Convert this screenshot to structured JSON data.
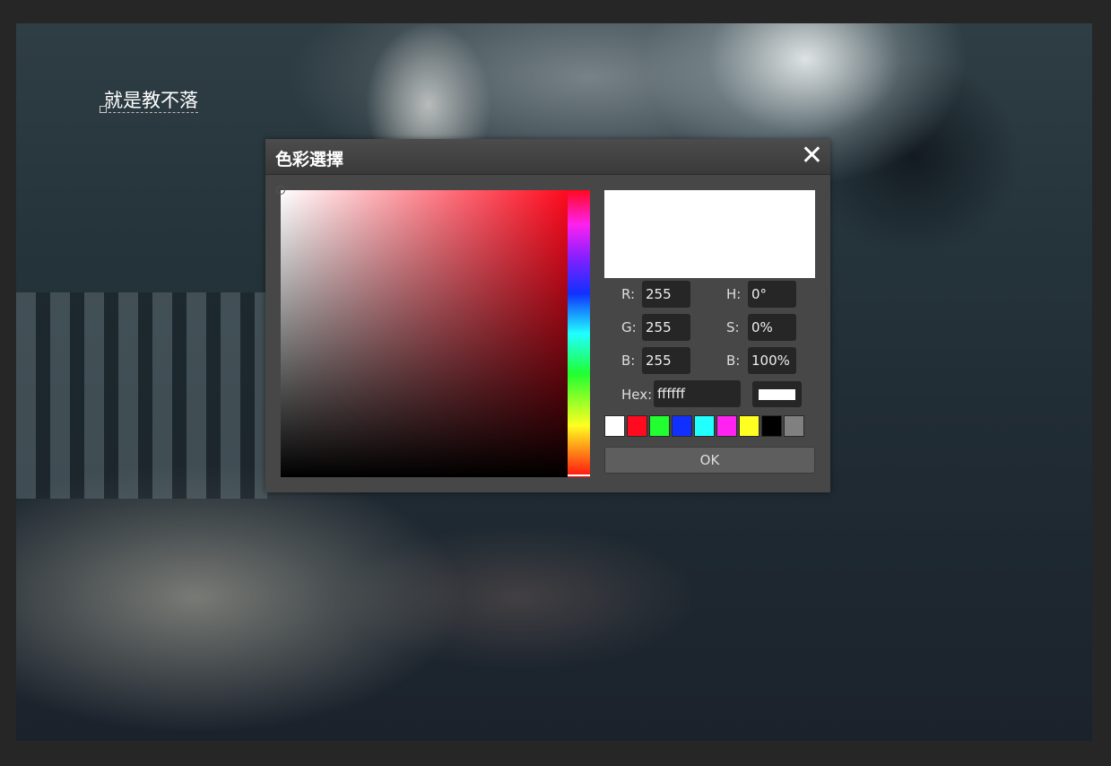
{
  "canvas": {
    "text_layer": "就是教不落"
  },
  "dialog": {
    "title": "色彩選擇",
    "close_icon": "close-icon",
    "hue_deg": 0,
    "saturation_pct": 0,
    "brightness_pct": 100,
    "fields": {
      "r_label": "R:",
      "r": "255",
      "g_label": "G:",
      "g": "255",
      "b_label": "B:",
      "b": "255",
      "h_label": "H:",
      "h": "0°",
      "s_label": "S:",
      "s": "0%",
      "v_label": "B:",
      "v": "100%",
      "hex_label": "Hex:",
      "hex": "ffffff"
    },
    "preview_color": "#ffffff",
    "palette": [
      "#ffffff",
      "#ff0a1e",
      "#22ff30",
      "#1030ff",
      "#22ffff",
      "#ff22f0",
      "#ffff22",
      "#000000",
      "#808080"
    ],
    "ok_label": "OK"
  }
}
